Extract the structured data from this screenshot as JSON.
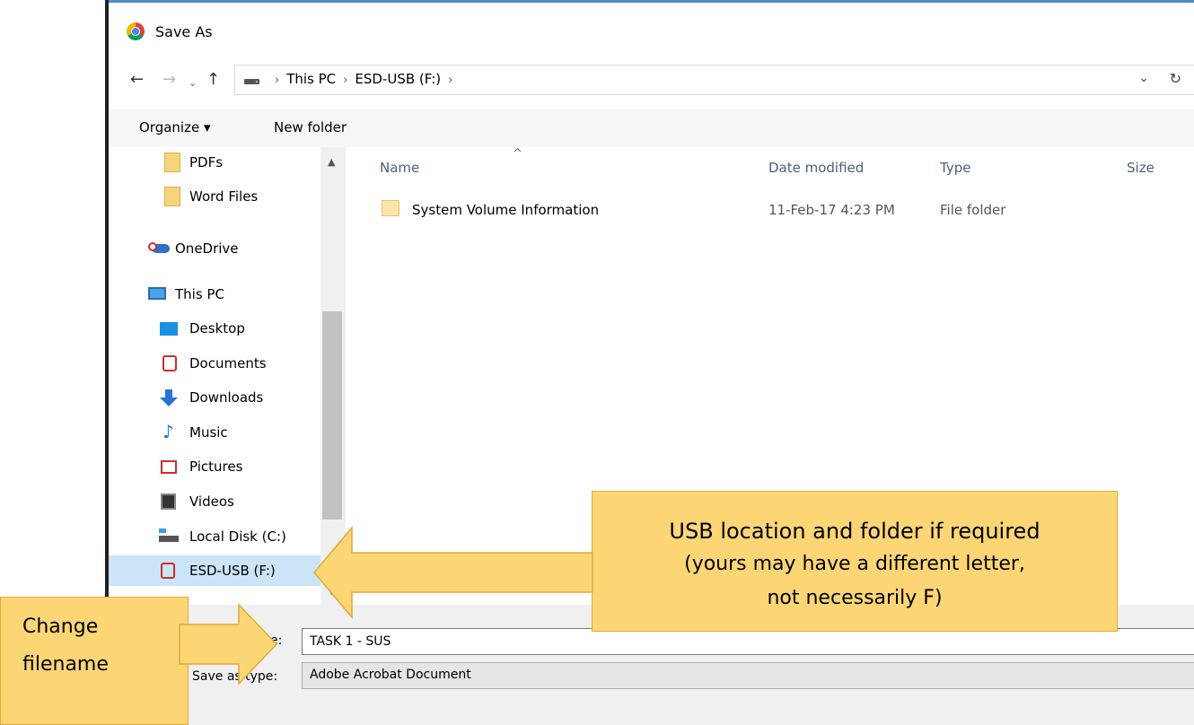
{
  "window": {
    "title": "Save As",
    "app_icon": "chrome-icon"
  },
  "nav": {
    "back_icon": "←",
    "forward_icon": "→",
    "recent_icon": "⌄",
    "up_icon": "↑",
    "crumbs": [
      "This PC",
      "ESD-USB (F:)"
    ],
    "sep": "›",
    "dropdown_icon": "⌄",
    "refresh_icon": "↻"
  },
  "toolbar": {
    "organize_label": "Organize ▾",
    "new_folder_label": "New folder"
  },
  "sidebar": {
    "items": [
      {
        "label": "PDFs",
        "icon": "folder-icon"
      },
      {
        "label": "Word Files",
        "icon": "folder-icon"
      },
      {
        "label": "OneDrive",
        "icon": "onedrive-icon"
      },
      {
        "label": "This PC",
        "icon": "computer-icon"
      },
      {
        "label": "Desktop",
        "icon": "desktop-icon"
      },
      {
        "label": "Documents",
        "icon": "documents-icon"
      },
      {
        "label": "Downloads",
        "icon": "downloads-icon"
      },
      {
        "label": "Music",
        "icon": "music-icon"
      },
      {
        "label": "Pictures",
        "icon": "pictures-icon"
      },
      {
        "label": "Videos",
        "icon": "videos-icon"
      },
      {
        "label": "Local Disk (C:)",
        "icon": "local-disk-icon"
      },
      {
        "label": "ESD-USB (F:)",
        "icon": "usb-drive-icon",
        "selected": true
      }
    ],
    "scroll_up": "▲",
    "scroll_down": "▼"
  },
  "filelist": {
    "sort_caret": "^",
    "columns": {
      "name": "Name",
      "date": "Date modified",
      "type": "Type",
      "size": "Size"
    },
    "rows": [
      {
        "name": "System Volume Information",
        "date": "11-Feb-17 4:23 PM",
        "type": "File folder"
      }
    ]
  },
  "form": {
    "filename_label": "File name:",
    "filename_label_visible": "e:",
    "filename_value": "TASK 1 - SUS",
    "savetype_label": "Save as type:",
    "savetype_value": "Adobe Acrobat Document"
  },
  "annotations": {
    "usb_title": "USB location and folder if required",
    "usb_sub1": "(yours may have a different letter,",
    "usb_sub2": "not necessarily F)",
    "change_line1": "Change",
    "change_line2": "filename"
  },
  "colors": {
    "callout_fill": "#fcd675",
    "callout_border": "#e0a93a",
    "selection": "#cce4f7",
    "accent": "#4a8cc7"
  }
}
